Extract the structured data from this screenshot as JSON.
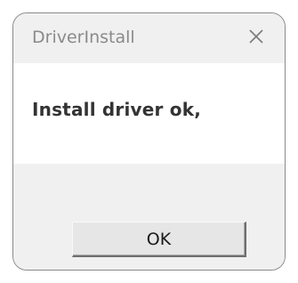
{
  "window": {
    "title": "DriverInstall",
    "close_icon": "close-icon"
  },
  "dialog": {
    "message": "Install driver ok,",
    "ok_label": "OK"
  },
  "colors": {
    "titlebar_bg": "#f0f0f0",
    "body_bg": "#ffffff",
    "title_text": "#8a8a8a",
    "message_text": "#333333",
    "button_bg": "#e6e6e6"
  }
}
